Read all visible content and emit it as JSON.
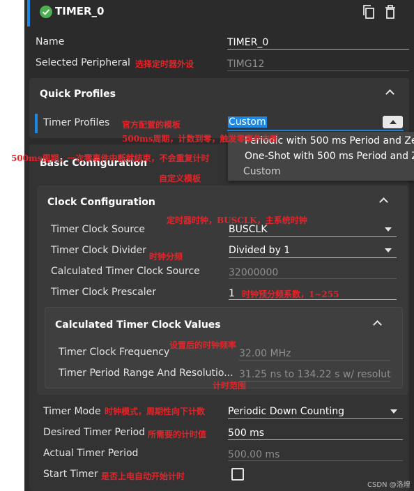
{
  "header": {
    "title": "TIMER_0"
  },
  "name_row": {
    "label": "Name",
    "value": "TIMER_0"
  },
  "peripheral_row": {
    "label": "Selected Peripheral",
    "value": "TIMG12"
  },
  "quick_profiles": {
    "title": "Quick Profiles",
    "row_label": "Timer Profiles",
    "value": "Custom",
    "options": [
      "Periodic with 500 ms Period and Ze",
      "One-Shot with 500 ms Period and Ze",
      "Custom"
    ]
  },
  "basic_config": {
    "title": "Basic Configuration"
  },
  "clock_config": {
    "title": "Clock Configuration",
    "rows": [
      {
        "label": "Timer Clock Source",
        "value": "BUSCLK"
      },
      {
        "label": "Timer Clock Divider",
        "value": "Divided by 1"
      },
      {
        "label": "Calculated Timer Clock Source",
        "value": "32000000"
      },
      {
        "label": "Timer Clock Prescaler",
        "value": "1"
      }
    ]
  },
  "calc_values": {
    "title": "Calculated Timer Clock Values",
    "rows": [
      {
        "label": "Timer Clock Frequency",
        "value": "32.00 MHz"
      },
      {
        "label": "Timer Period Range And Resolutio...",
        "value": "31.25 ns to 134.22 s w/ resoluti"
      }
    ]
  },
  "timer_rows": [
    {
      "label": "Timer Mode",
      "value": "Periodic Down Counting"
    },
    {
      "label": "Desired Timer Period",
      "value": "500 ms"
    },
    {
      "label": "Actual Timer Period",
      "value": "500.00 ms"
    },
    {
      "label": "Start Timer"
    }
  ],
  "annotations": {
    "peripheral": "选择定时器外设",
    "profiles": "官方配置的模板",
    "periodic": "500ms周期，计数到零，触发零事件中断",
    "oneshot": "500ms周期，一次零事件中断就结束，不会重复计时",
    "custom": "自定义模板",
    "clock_source": "定时器时钟，BUSCLK，主系统时钟",
    "divider": "时钟分频",
    "prescaler": "时钟预分频系数，1~255",
    "frequency": "设置后的时钟频率",
    "range": "计时范围",
    "mode": "时钟模式，周期性向下计数",
    "desired": "所需要的计时值",
    "start": "是否上电自动开始计时"
  },
  "watermark": "CSDN @洛煌",
  "colors": {
    "background": "#2b2b2b",
    "card": "#363636",
    "inner_card": "#3a3a3a",
    "accent": "#1e88e5",
    "success": "#4caf50",
    "annotation": "#e0262b"
  }
}
